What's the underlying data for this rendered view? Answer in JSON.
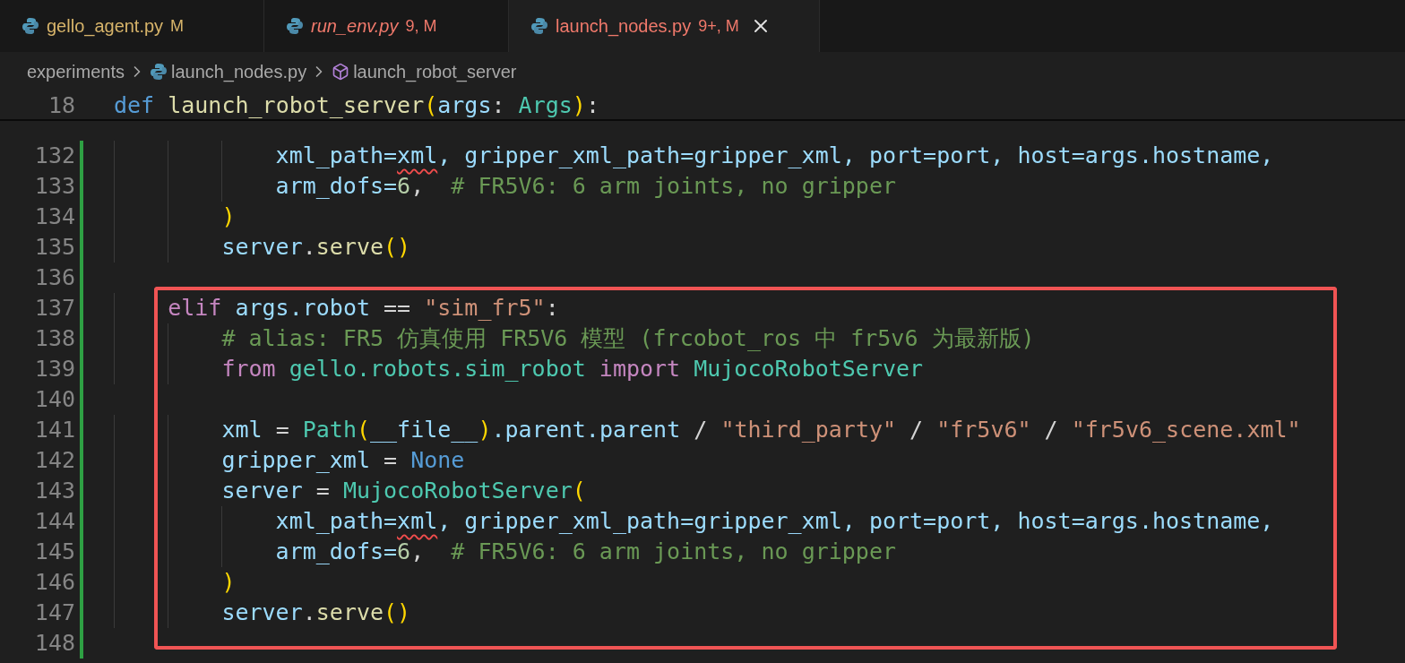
{
  "tabs": [
    {
      "label": "gello_agent.py",
      "badge": "M",
      "has_errors": false,
      "preview": false,
      "selected": false
    },
    {
      "label": "run_env.py",
      "badge": "9, M",
      "has_errors": true,
      "preview": true,
      "selected": false
    },
    {
      "label": "launch_nodes.py",
      "badge": "9+, M",
      "has_errors": true,
      "preview": false,
      "selected": true
    }
  ],
  "breadcrumb": [
    {
      "kind": "folder",
      "label": "experiments"
    },
    {
      "kind": "file",
      "label": "launch_nodes.py"
    },
    {
      "kind": "symbol",
      "label": "launch_robot_server"
    }
  ],
  "sticky_line": {
    "number": "18",
    "tokens": [
      {
        "kind": "kw",
        "text": "def "
      },
      {
        "kind": "fn",
        "text": "launch_robot_server"
      },
      {
        "kind": "paren",
        "text": "("
      },
      {
        "kind": "var",
        "text": "args"
      },
      {
        "kind": "op",
        "text": ": "
      },
      {
        "kind": "cls",
        "text": "Args"
      },
      {
        "kind": "paren",
        "text": ")"
      },
      {
        "kind": "op",
        "text": ":"
      }
    ]
  },
  "lines": [
    {
      "number": "132",
      "changed": true,
      "highlighted": false,
      "tokens": [
        {
          "kind": "var",
          "text": "            xml_path="
        },
        {
          "kind": "var",
          "text": "xml",
          "error": true
        },
        {
          "kind": "var",
          "text": ", gripper_xml_path=gripper_xml, port=port, host=args.hostname,"
        }
      ]
    },
    {
      "number": "133",
      "changed": true,
      "highlighted": false,
      "tokens": [
        {
          "kind": "var",
          "text": "            arm_dofs="
        },
        {
          "kind": "num",
          "text": "6"
        },
        {
          "kind": "op",
          "text": ",  "
        },
        {
          "kind": "cmt",
          "text": "# FR5V6: 6 arm joints, no gripper"
        }
      ]
    },
    {
      "number": "134",
      "changed": true,
      "highlighted": false,
      "tokens": [
        {
          "kind": "paren",
          "text": "        )"
        }
      ]
    },
    {
      "number": "135",
      "changed": true,
      "highlighted": false,
      "tokens": [
        {
          "kind": "var",
          "text": "        server"
        },
        {
          "kind": "op",
          "text": "."
        },
        {
          "kind": "fn",
          "text": "serve"
        },
        {
          "kind": "paren",
          "text": "()"
        }
      ]
    },
    {
      "number": "136",
      "changed": true,
      "highlighted": false
    },
    {
      "number": "137",
      "changed": true,
      "highlighted": true,
      "tokens": [
        {
          "kind": "ctl",
          "text": "    elif "
        },
        {
          "kind": "var",
          "text": "args.robot"
        },
        {
          "kind": "op",
          "text": " == "
        },
        {
          "kind": "str",
          "text": "\"sim_fr5\""
        },
        {
          "kind": "op",
          "text": ":"
        }
      ]
    },
    {
      "number": "138",
      "changed": true,
      "highlighted": true,
      "tokens": [
        {
          "kind": "cmt",
          "text": "        # alias: FR5 仿真使用 FR5V6 模型 (frcobot_ros 中 fr5v6 为最新版)"
        }
      ]
    },
    {
      "number": "139",
      "changed": true,
      "highlighted": true,
      "tokens": [
        {
          "kind": "ctl",
          "text": "        from "
        },
        {
          "kind": "cls",
          "text": "gello.robots.sim_robot "
        },
        {
          "kind": "ctl",
          "text": "import "
        },
        {
          "kind": "cls",
          "text": "MujocoRobotServer"
        }
      ]
    },
    {
      "number": "140",
      "changed": true,
      "highlighted": true
    },
    {
      "number": "141",
      "changed": true,
      "highlighted": true,
      "tokens": [
        {
          "kind": "var",
          "text": "        xml"
        },
        {
          "kind": "op",
          "text": " = "
        },
        {
          "kind": "cls",
          "text": "Path"
        },
        {
          "kind": "paren",
          "text": "("
        },
        {
          "kind": "var",
          "text": "__file__"
        },
        {
          "kind": "paren",
          "text": ")"
        },
        {
          "kind": "var",
          "text": ".parent.parent"
        },
        {
          "kind": "op",
          "text": " / "
        },
        {
          "kind": "str",
          "text": "\"third_party\""
        },
        {
          "kind": "op",
          "text": " / "
        },
        {
          "kind": "str",
          "text": "\"fr5v6\""
        },
        {
          "kind": "op",
          "text": " / "
        },
        {
          "kind": "str",
          "text": "\"fr5v6_scene.xml\""
        }
      ]
    },
    {
      "number": "142",
      "changed": true,
      "highlighted": true,
      "tokens": [
        {
          "kind": "var",
          "text": "        gripper_xml"
        },
        {
          "kind": "op",
          "text": " = "
        },
        {
          "kind": "kw",
          "text": "None"
        }
      ]
    },
    {
      "number": "143",
      "changed": true,
      "highlighted": true,
      "tokens": [
        {
          "kind": "var",
          "text": "        server"
        },
        {
          "kind": "op",
          "text": " = "
        },
        {
          "kind": "cls",
          "text": "MujocoRobotServer"
        },
        {
          "kind": "paren",
          "text": "("
        }
      ]
    },
    {
      "number": "144",
      "changed": true,
      "highlighted": true,
      "tokens": [
        {
          "kind": "var",
          "text": "            xml_path="
        },
        {
          "kind": "var",
          "text": "xml",
          "error": true
        },
        {
          "kind": "var",
          "text": ", gripper_xml_path=gripper_xml, port=port, host=args.hostname,"
        }
      ]
    },
    {
      "number": "145",
      "changed": true,
      "highlighted": true,
      "tokens": [
        {
          "kind": "var",
          "text": "            arm_dofs="
        },
        {
          "kind": "num",
          "text": "6"
        },
        {
          "kind": "op",
          "text": ",  "
        },
        {
          "kind": "cmt",
          "text": "# FR5V6: 6 arm joints, no gripper"
        }
      ]
    },
    {
      "number": "146",
      "changed": true,
      "highlighted": true,
      "tokens": [
        {
          "kind": "paren",
          "text": "        )"
        }
      ]
    },
    {
      "number": "147",
      "changed": true,
      "highlighted": true,
      "tokens": [
        {
          "kind": "var",
          "text": "        server"
        },
        {
          "kind": "op",
          "text": "."
        },
        {
          "kind": "fn",
          "text": "serve"
        },
        {
          "kind": "paren",
          "text": "()"
        }
      ]
    },
    {
      "number": "148",
      "changed": true,
      "highlighted": false
    }
  ]
}
